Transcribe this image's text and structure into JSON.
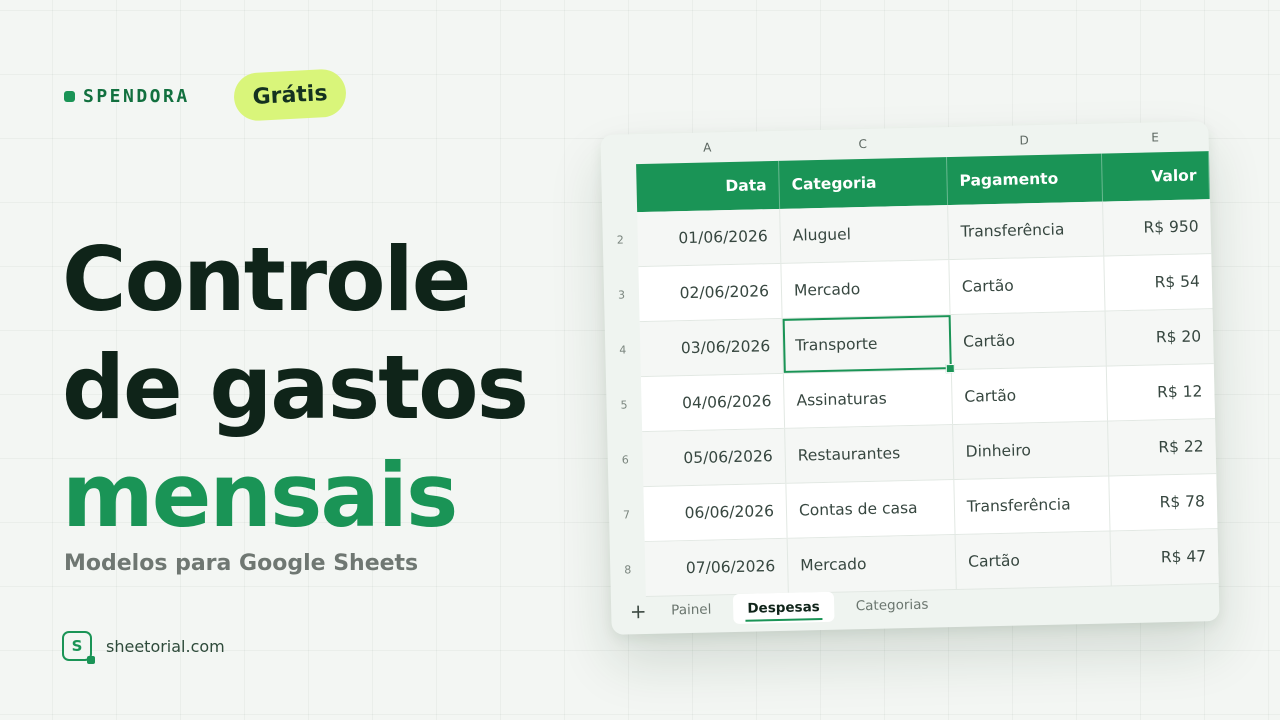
{
  "brand": {
    "name": "SPENDORA",
    "badge": "Grátis"
  },
  "headline": {
    "line1": "Controle",
    "line2": "de gastos",
    "line3": "mensais"
  },
  "subtitle": "Modelos para Google Sheets",
  "footer": {
    "logo_letter": "S",
    "site": "sheetorial.com"
  },
  "colors": {
    "accent": "#1a9456",
    "badge": "#d9f57a",
    "dark_text": "#0f2419"
  },
  "sheet": {
    "column_letters": [
      "A",
      "C",
      "D",
      "E"
    ],
    "headers": [
      "Data",
      "Categoria",
      "Pagamento",
      "Valor"
    ],
    "row_numbers": [
      "2",
      "3",
      "4",
      "5",
      "6",
      "7",
      "8"
    ],
    "selected_row": 2,
    "rows": [
      {
        "date": "01/06/2026",
        "category": "Aluguel",
        "payment": "Transferência",
        "value": "R$ 950"
      },
      {
        "date": "02/06/2026",
        "category": "Mercado",
        "payment": "Cartão",
        "value": "R$ 54"
      },
      {
        "date": "03/06/2026",
        "category": "Transporte",
        "payment": "Cartão",
        "value": "R$ 20"
      },
      {
        "date": "04/06/2026",
        "category": "Assinaturas",
        "payment": "Cartão",
        "value": "R$ 12"
      },
      {
        "date": "05/06/2026",
        "category": "Restaurantes",
        "payment": "Dinheiro",
        "value": "R$ 22"
      },
      {
        "date": "06/06/2026",
        "category": "Contas de casa",
        "payment": "Transferência",
        "value": "R$ 78"
      },
      {
        "date": "07/06/2026",
        "category": "Mercado",
        "payment": "Cartão",
        "value": "R$ 47"
      }
    ],
    "tabs": {
      "add_icon": "plus-icon",
      "items": [
        "Painel",
        "Despesas",
        "Categorias"
      ],
      "active": 1
    }
  }
}
